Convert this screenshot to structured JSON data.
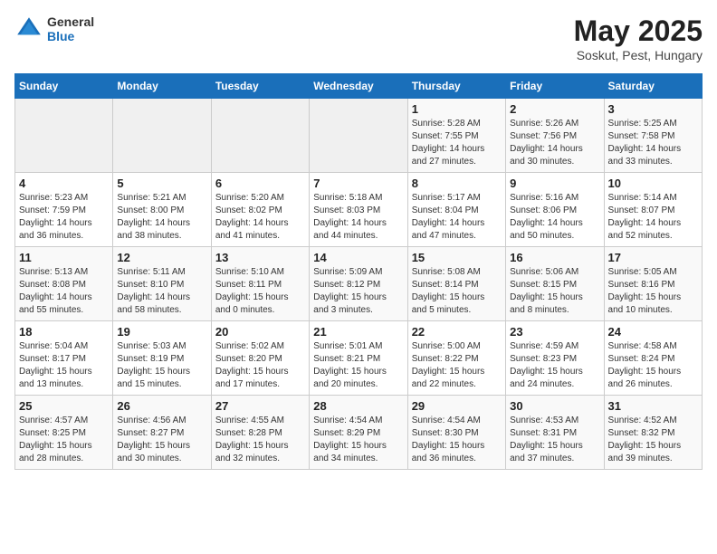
{
  "header": {
    "logo_general": "General",
    "logo_blue": "Blue",
    "title": "May 2025",
    "subtitle": "Soskut, Pest, Hungary"
  },
  "columns": [
    "Sunday",
    "Monday",
    "Tuesday",
    "Wednesday",
    "Thursday",
    "Friday",
    "Saturday"
  ],
  "weeks": [
    [
      {
        "day": "",
        "info": ""
      },
      {
        "day": "",
        "info": ""
      },
      {
        "day": "",
        "info": ""
      },
      {
        "day": "",
        "info": ""
      },
      {
        "day": "1",
        "info": "Sunrise: 5:28 AM\nSunset: 7:55 PM\nDaylight: 14 hours\nand 27 minutes."
      },
      {
        "day": "2",
        "info": "Sunrise: 5:26 AM\nSunset: 7:56 PM\nDaylight: 14 hours\nand 30 minutes."
      },
      {
        "day": "3",
        "info": "Sunrise: 5:25 AM\nSunset: 7:58 PM\nDaylight: 14 hours\nand 33 minutes."
      }
    ],
    [
      {
        "day": "4",
        "info": "Sunrise: 5:23 AM\nSunset: 7:59 PM\nDaylight: 14 hours\nand 36 minutes."
      },
      {
        "day": "5",
        "info": "Sunrise: 5:21 AM\nSunset: 8:00 PM\nDaylight: 14 hours\nand 38 minutes."
      },
      {
        "day": "6",
        "info": "Sunrise: 5:20 AM\nSunset: 8:02 PM\nDaylight: 14 hours\nand 41 minutes."
      },
      {
        "day": "7",
        "info": "Sunrise: 5:18 AM\nSunset: 8:03 PM\nDaylight: 14 hours\nand 44 minutes."
      },
      {
        "day": "8",
        "info": "Sunrise: 5:17 AM\nSunset: 8:04 PM\nDaylight: 14 hours\nand 47 minutes."
      },
      {
        "day": "9",
        "info": "Sunrise: 5:16 AM\nSunset: 8:06 PM\nDaylight: 14 hours\nand 50 minutes."
      },
      {
        "day": "10",
        "info": "Sunrise: 5:14 AM\nSunset: 8:07 PM\nDaylight: 14 hours\nand 52 minutes."
      }
    ],
    [
      {
        "day": "11",
        "info": "Sunrise: 5:13 AM\nSunset: 8:08 PM\nDaylight: 14 hours\nand 55 minutes."
      },
      {
        "day": "12",
        "info": "Sunrise: 5:11 AM\nSunset: 8:10 PM\nDaylight: 14 hours\nand 58 minutes."
      },
      {
        "day": "13",
        "info": "Sunrise: 5:10 AM\nSunset: 8:11 PM\nDaylight: 15 hours\nand 0 minutes."
      },
      {
        "day": "14",
        "info": "Sunrise: 5:09 AM\nSunset: 8:12 PM\nDaylight: 15 hours\nand 3 minutes."
      },
      {
        "day": "15",
        "info": "Sunrise: 5:08 AM\nSunset: 8:14 PM\nDaylight: 15 hours\nand 5 minutes."
      },
      {
        "day": "16",
        "info": "Sunrise: 5:06 AM\nSunset: 8:15 PM\nDaylight: 15 hours\nand 8 minutes."
      },
      {
        "day": "17",
        "info": "Sunrise: 5:05 AM\nSunset: 8:16 PM\nDaylight: 15 hours\nand 10 minutes."
      }
    ],
    [
      {
        "day": "18",
        "info": "Sunrise: 5:04 AM\nSunset: 8:17 PM\nDaylight: 15 hours\nand 13 minutes."
      },
      {
        "day": "19",
        "info": "Sunrise: 5:03 AM\nSunset: 8:19 PM\nDaylight: 15 hours\nand 15 minutes."
      },
      {
        "day": "20",
        "info": "Sunrise: 5:02 AM\nSunset: 8:20 PM\nDaylight: 15 hours\nand 17 minutes."
      },
      {
        "day": "21",
        "info": "Sunrise: 5:01 AM\nSunset: 8:21 PM\nDaylight: 15 hours\nand 20 minutes."
      },
      {
        "day": "22",
        "info": "Sunrise: 5:00 AM\nSunset: 8:22 PM\nDaylight: 15 hours\nand 22 minutes."
      },
      {
        "day": "23",
        "info": "Sunrise: 4:59 AM\nSunset: 8:23 PM\nDaylight: 15 hours\nand 24 minutes."
      },
      {
        "day": "24",
        "info": "Sunrise: 4:58 AM\nSunset: 8:24 PM\nDaylight: 15 hours\nand 26 minutes."
      }
    ],
    [
      {
        "day": "25",
        "info": "Sunrise: 4:57 AM\nSunset: 8:25 PM\nDaylight: 15 hours\nand 28 minutes."
      },
      {
        "day": "26",
        "info": "Sunrise: 4:56 AM\nSunset: 8:27 PM\nDaylight: 15 hours\nand 30 minutes."
      },
      {
        "day": "27",
        "info": "Sunrise: 4:55 AM\nSunset: 8:28 PM\nDaylight: 15 hours\nand 32 minutes."
      },
      {
        "day": "28",
        "info": "Sunrise: 4:54 AM\nSunset: 8:29 PM\nDaylight: 15 hours\nand 34 minutes."
      },
      {
        "day": "29",
        "info": "Sunrise: 4:54 AM\nSunset: 8:30 PM\nDaylight: 15 hours\nand 36 minutes."
      },
      {
        "day": "30",
        "info": "Sunrise: 4:53 AM\nSunset: 8:31 PM\nDaylight: 15 hours\nand 37 minutes."
      },
      {
        "day": "31",
        "info": "Sunrise: 4:52 AM\nSunset: 8:32 PM\nDaylight: 15 hours\nand 39 minutes."
      }
    ]
  ]
}
